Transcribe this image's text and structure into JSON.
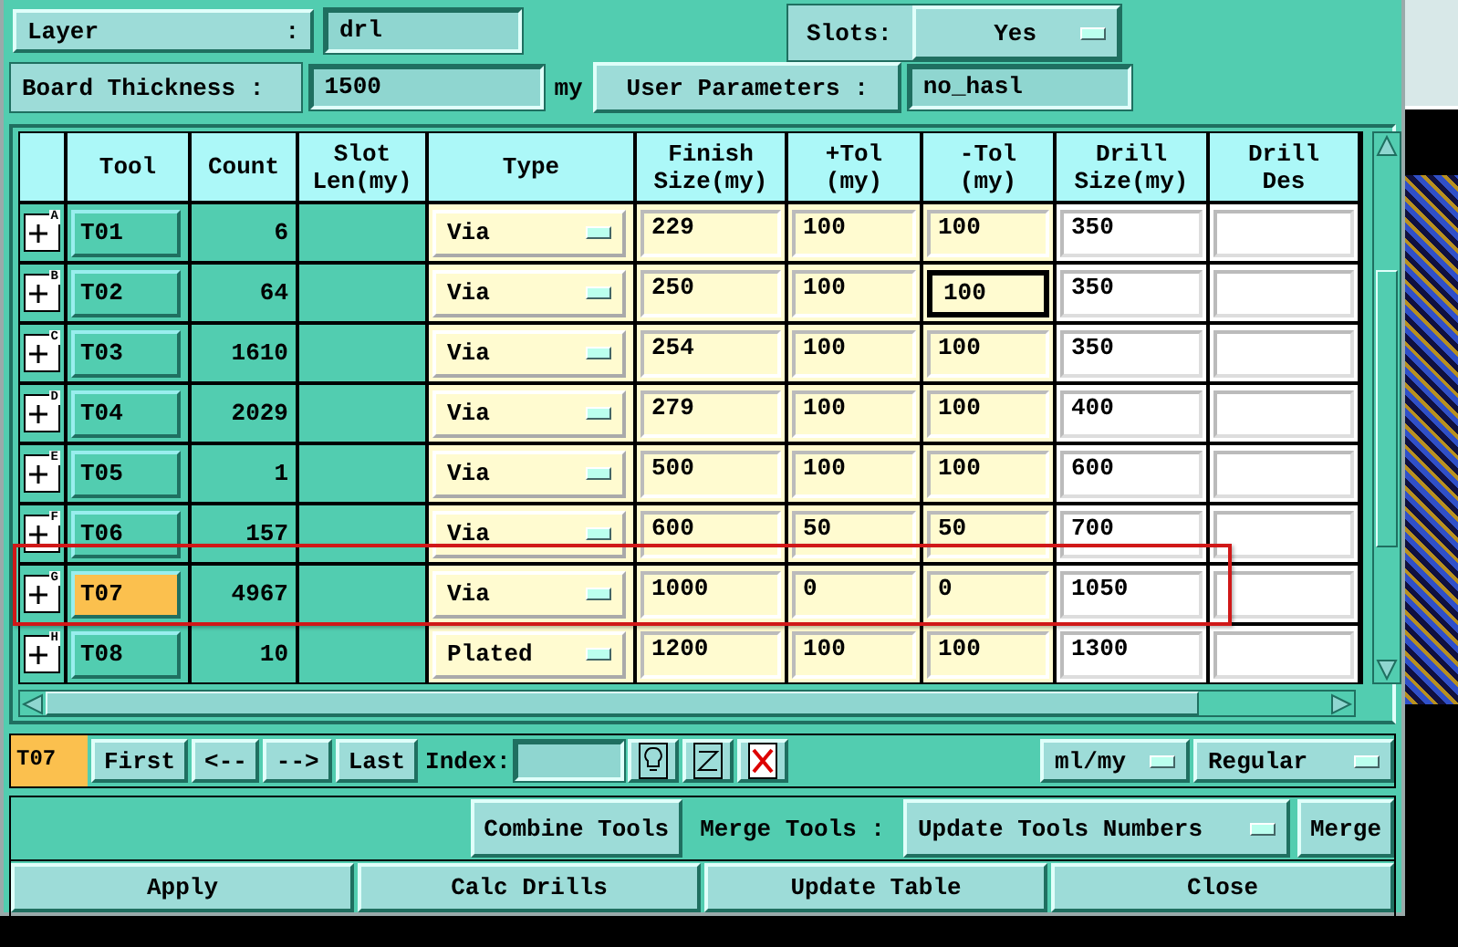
{
  "header": {
    "layer_label": "Layer",
    "layer_colon": ":",
    "layer_value": "drl",
    "slots_label": "Slots:",
    "slots_value": "Yes",
    "thickness_label": "Board Thickness :",
    "thickness_value": "1500",
    "thickness_unit": "my",
    "user_params_label": "User Parameters :",
    "user_params_value": "no_hasl"
  },
  "table": {
    "columns": [
      [
        "Tool"
      ],
      [
        "Count"
      ],
      [
        "Slot",
        "Len(my)"
      ],
      [
        "Type"
      ],
      [
        "Finish",
        "Size(my)"
      ],
      [
        "+Tol",
        "(my)"
      ],
      [
        "-Tol",
        "(my)"
      ],
      [
        "Drill",
        "Size(my)"
      ],
      [
        "Drill",
        "Des"
      ]
    ],
    "rows": [
      {
        "marker": "A",
        "tool": "T01",
        "count": "6",
        "type": "Via",
        "finish": "229",
        "plus_tol": "100",
        "minus_tol": "100",
        "drill": "350",
        "selected": false
      },
      {
        "marker": "B",
        "tool": "T02",
        "count": "64",
        "type": "Via",
        "finish": "250",
        "plus_tol": "100",
        "minus_tol": "100",
        "drill": "350",
        "selected": false,
        "minus_tol_focused": true
      },
      {
        "marker": "C",
        "tool": "T03",
        "count": "1610",
        "type": "Via",
        "finish": "254",
        "plus_tol": "100",
        "minus_tol": "100",
        "drill": "350",
        "selected": false
      },
      {
        "marker": "D",
        "tool": "T04",
        "count": "2029",
        "type": "Via",
        "finish": "279",
        "plus_tol": "100",
        "minus_tol": "100",
        "drill": "400",
        "selected": false
      },
      {
        "marker": "E",
        "tool": "T05",
        "count": "1",
        "type": "Via",
        "finish": "500",
        "plus_tol": "100",
        "minus_tol": "100",
        "drill": "600",
        "selected": false
      },
      {
        "marker": "F",
        "tool": "T06",
        "count": "157",
        "type": "Via",
        "finish": "600",
        "plus_tol": "50",
        "minus_tol": "50",
        "drill": "700",
        "selected": false
      },
      {
        "marker": "G",
        "tool": "T07",
        "count": "4967",
        "type": "Via",
        "finish": "1000",
        "plus_tol": "0",
        "minus_tol": "0",
        "drill": "1050",
        "selected": true
      },
      {
        "marker": "H",
        "tool": "T08",
        "count": "10",
        "type": "Plated",
        "finish": "1200",
        "plus_tol": "100",
        "minus_tol": "100",
        "drill": "1300",
        "selected": false
      }
    ]
  },
  "navigation": {
    "current_tool": "T07",
    "buttons": [
      "First",
      "<--",
      "-->",
      "Last"
    ],
    "index_label": "Index:",
    "units": "ml/my",
    "mode": "Regular"
  },
  "merge": {
    "combine_button": "Combine Tools",
    "merge_label": "Merge Tools :",
    "merge_option": "Update Tools Numbers",
    "merge_button": "Merge"
  },
  "actions": [
    "Apply",
    "Calc Drills",
    "Update Table",
    "Close"
  ]
}
